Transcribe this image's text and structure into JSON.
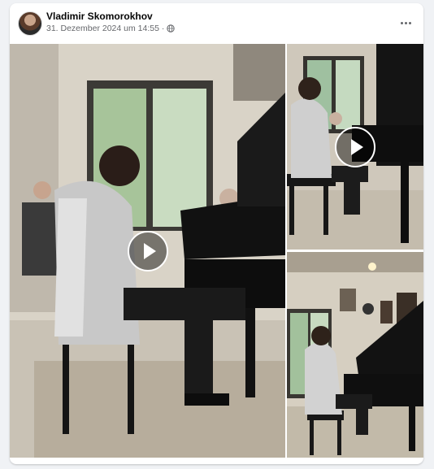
{
  "post": {
    "author": "Vladimir Skomorokhov",
    "date": "31. Dezember 2024 um 14:55",
    "separator": "·",
    "privacy_icon": "globe-icon",
    "more_icon": "more-horizontal-icon"
  },
  "media": [
    {
      "kind": "video",
      "play_icon": "play-icon"
    },
    {
      "kind": "video",
      "play_icon": "play-icon"
    },
    {
      "kind": "video",
      "play_icon": "play-icon"
    }
  ]
}
